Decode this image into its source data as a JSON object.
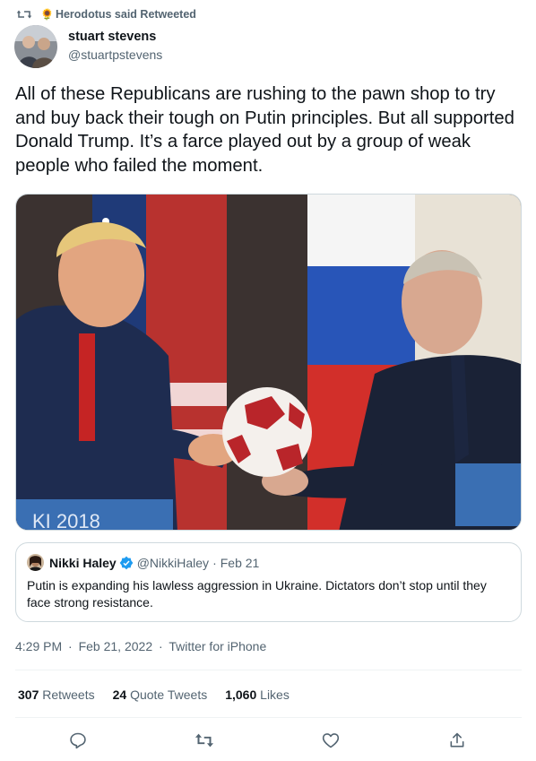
{
  "retweet_context": {
    "icon": "retweet-icon",
    "emoji": "🌻",
    "text": "Herodotus said Retweeted"
  },
  "author": {
    "display_name": "stuart stevens",
    "handle": "@stuartpstevens",
    "avatar": "avatar-photo"
  },
  "tweet": {
    "text": "All of these Republicans are rushing to the pawn shop to try and buy back their tough on Putin principles. But all supported Donald Trump. It’s a farce played out by a group of weak people who failed the moment.",
    "media": {
      "podium_text": "KI 2018"
    }
  },
  "quote": {
    "display_name": "Nikki Haley",
    "handle": "@NikkiHaley",
    "separator": "·",
    "date": "Feb 21",
    "text": "Putin is expanding his lawless aggression in Ukraine. Dictators don’t stop until they face strong resistance."
  },
  "meta": {
    "time": "4:29 PM",
    "sep": "·",
    "date": "Feb 21, 2022",
    "sep2": "·",
    "source": "Twitter for iPhone"
  },
  "stats": [
    {
      "count": "307",
      "label": "Retweets"
    },
    {
      "count": "24",
      "label": "Quote Tweets"
    },
    {
      "count": "1,060",
      "label": "Likes"
    }
  ],
  "actions": [
    "reply-icon",
    "retweet-icon",
    "like-icon",
    "share-icon"
  ],
  "colors": {
    "text": "#0f1419",
    "muted": "#536471",
    "border": "#cfd9de",
    "verified": "#1d9bf0"
  }
}
